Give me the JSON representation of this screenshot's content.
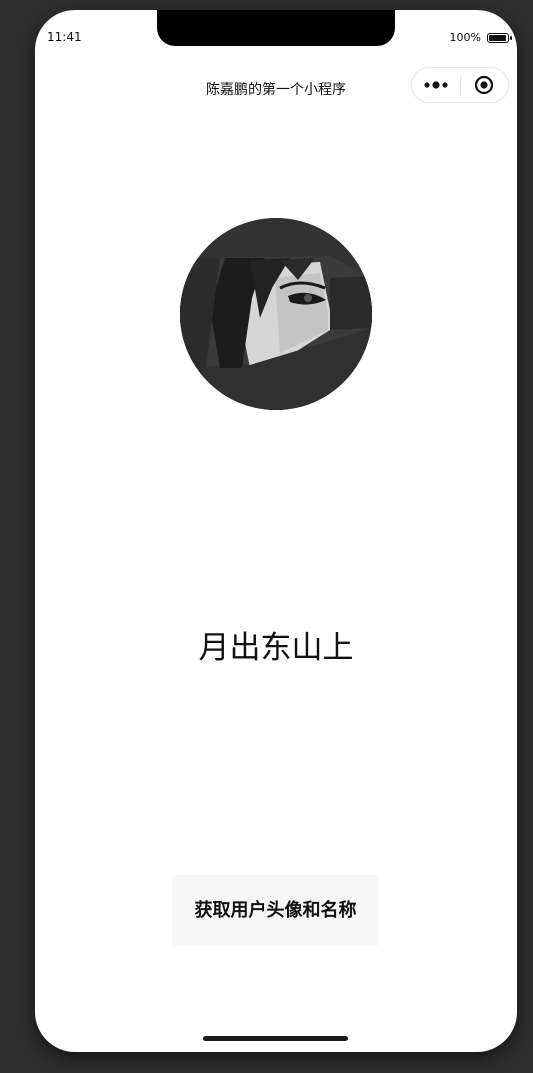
{
  "status_bar": {
    "time": "11:41",
    "battery_percent": "100%",
    "battery_level": 1.0
  },
  "nav_bar": {
    "title": "陈嘉鹏的第一个小程序",
    "more_icon": "more-dots-icon",
    "close_icon": "target-circle-icon"
  },
  "profile": {
    "avatar_icon": "avatar-image",
    "nickname": "月出东山上"
  },
  "actions": {
    "get_user_label": "获取用户头像和名称"
  },
  "colors": {
    "background": "#2f2f2f",
    "page": "#ffffff",
    "button_bg": "#f7f7f7",
    "text": "#111111"
  }
}
